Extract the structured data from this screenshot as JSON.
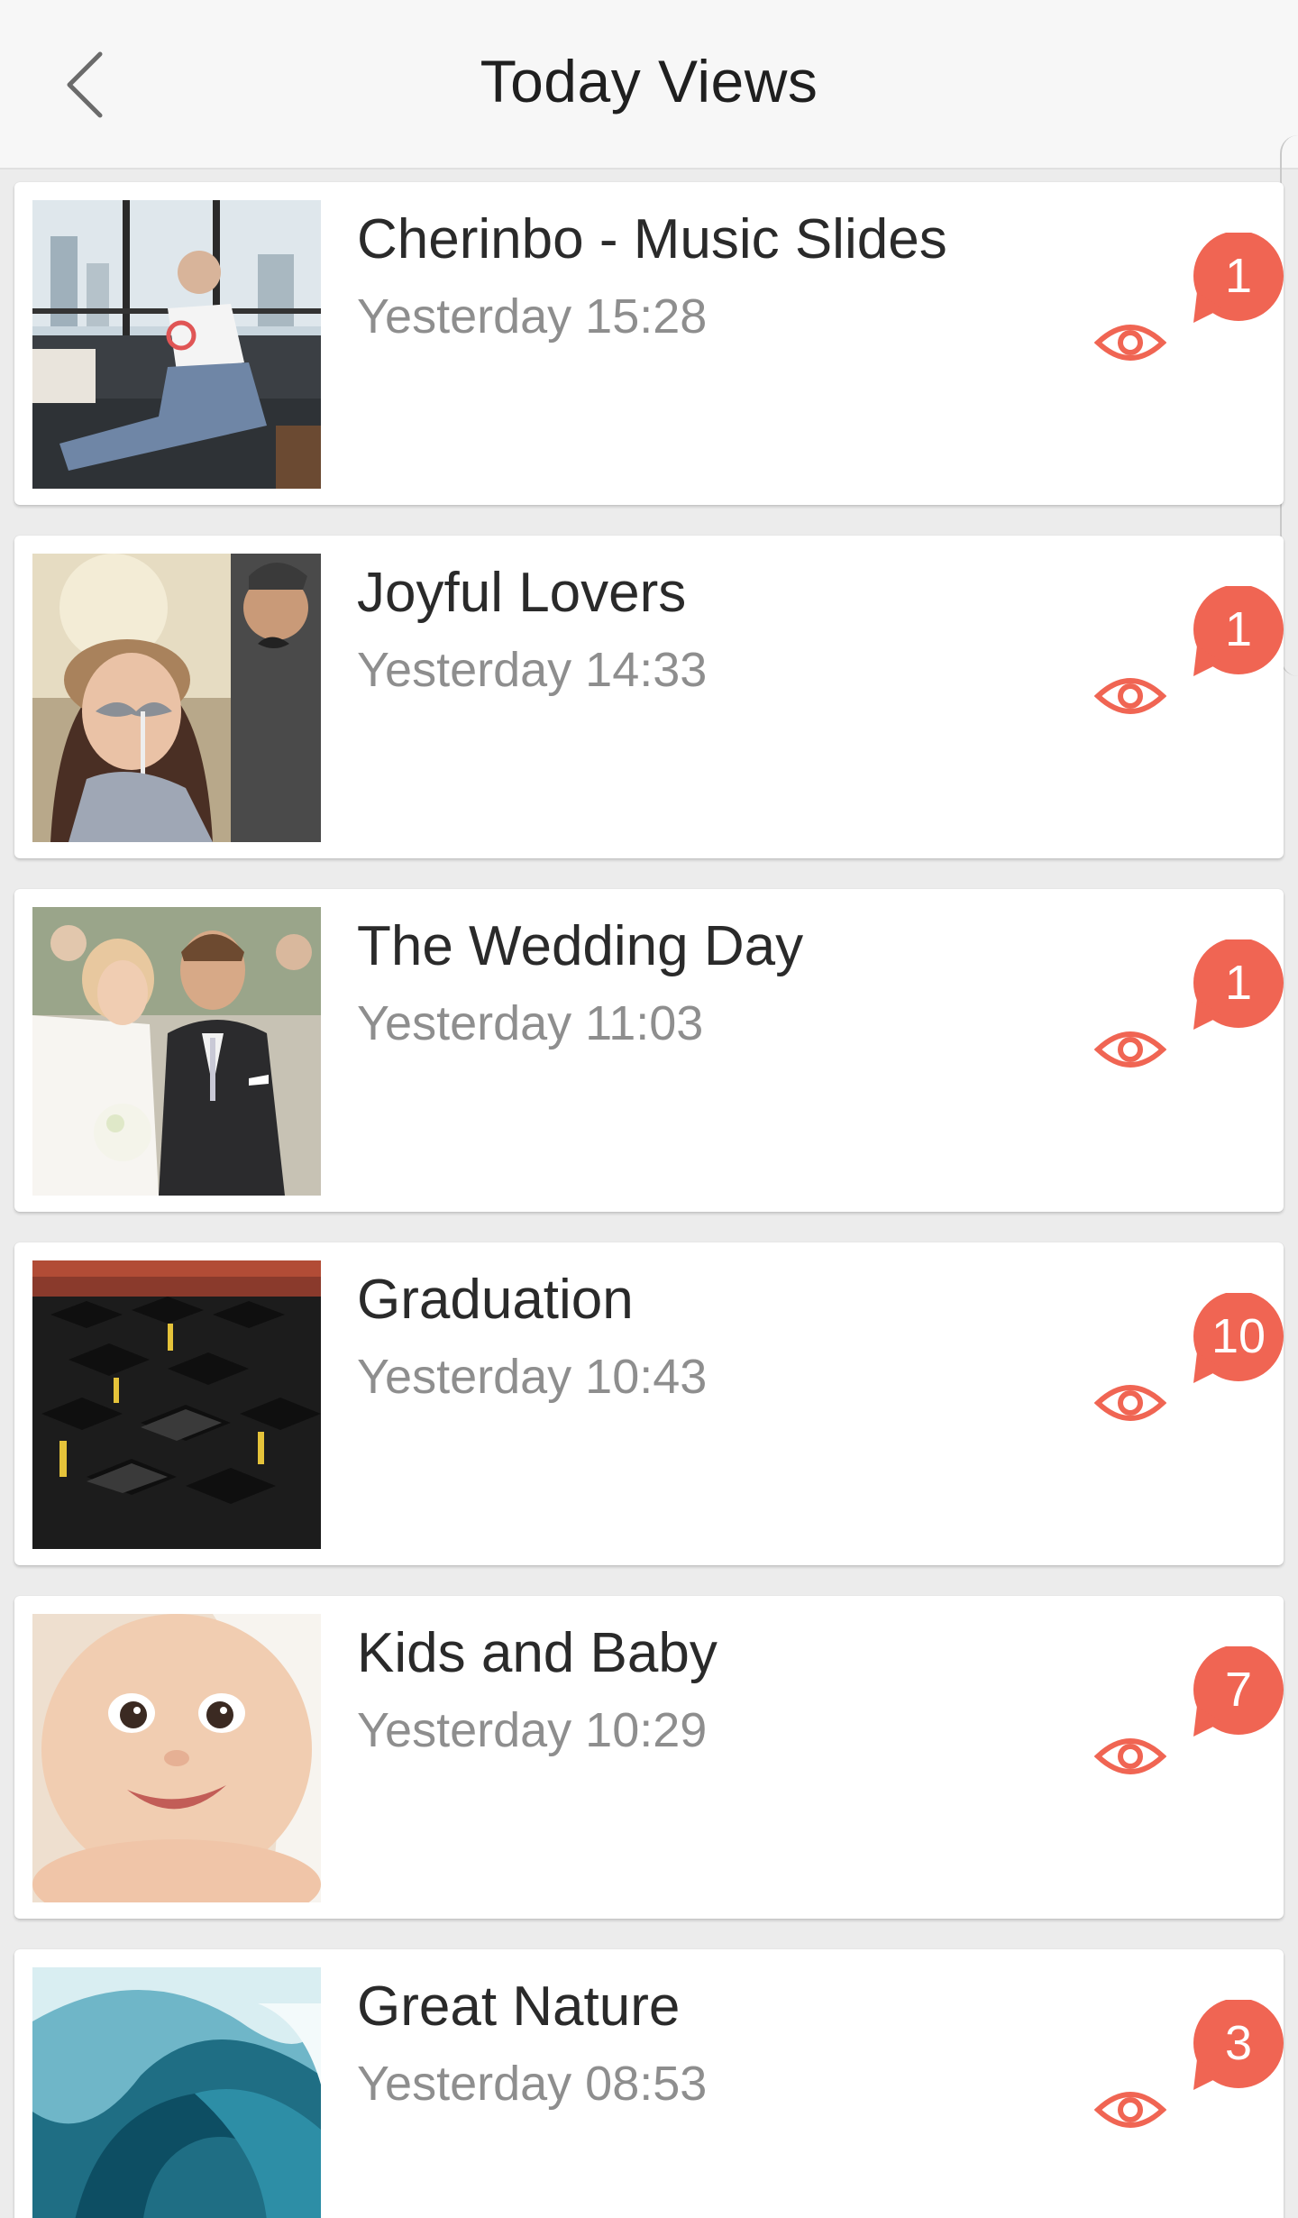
{
  "header": {
    "title": "Today Views",
    "back_icon": "chevron-left-icon"
  },
  "colors": {
    "accent": "#f06553",
    "title_text": "#2a2a2a",
    "time_text": "#8e8e8e"
  },
  "items": [
    {
      "title": "Cherinbo - Music Slides",
      "time": "Yesterday 15:28",
      "views": "1",
      "thumbnail": "man-on-sofa-photo"
    },
    {
      "title": "Joyful Lovers",
      "time": "Yesterday 14:33",
      "views": "1",
      "thumbnail": "couple-mustache-photo"
    },
    {
      "title": "The Wedding Day",
      "time": "Yesterday 11:03",
      "views": "1",
      "thumbnail": "bride-groom-photo"
    },
    {
      "title": "Graduation",
      "time": "Yesterday 10:43",
      "views": "10",
      "thumbnail": "graduation-caps-photo"
    },
    {
      "title": "Kids and Baby",
      "time": "Yesterday 10:29",
      "views": "7",
      "thumbnail": "baby-face-photo"
    },
    {
      "title": "Great Nature",
      "time": "Yesterday 08:53",
      "views": "3",
      "thumbnail": "ocean-wave-photo"
    }
  ]
}
